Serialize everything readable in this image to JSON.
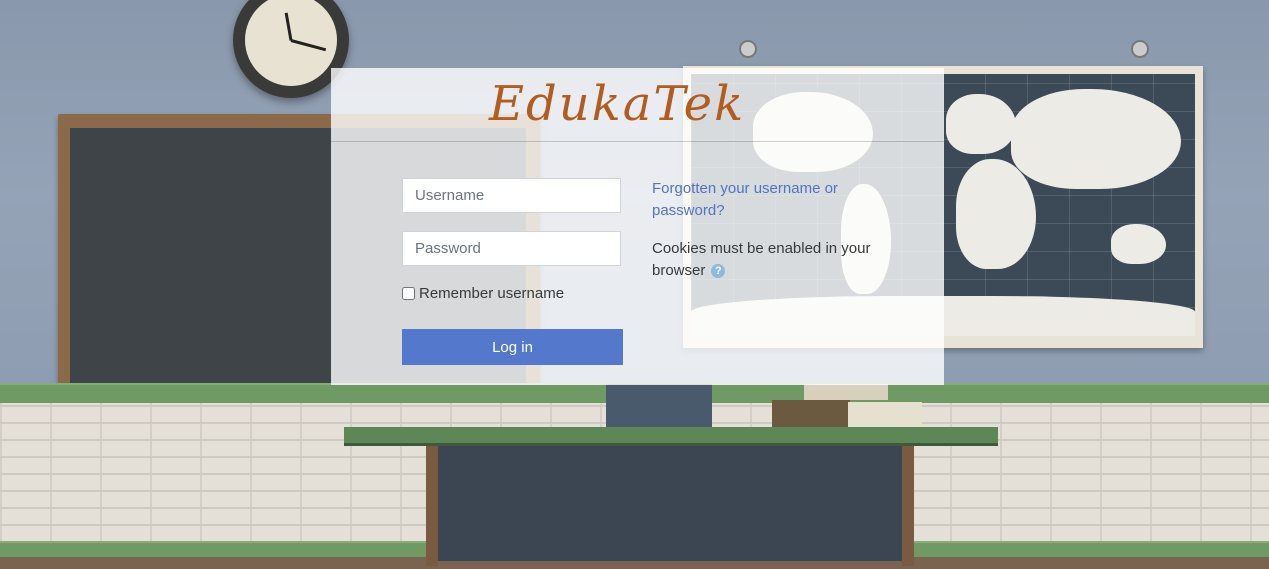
{
  "brand": {
    "logo_text": "EdukaTek",
    "logo_color": "#b25d1f"
  },
  "login_form": {
    "username_placeholder": "Username",
    "username_value": "",
    "password_placeholder": "Password",
    "password_value": "",
    "remember_label": "Remember username",
    "remember_checked": false,
    "login_button": "Log in",
    "accent_color": "#5478cb"
  },
  "help": {
    "forgot_link": "Forgotten your username or password?",
    "cookies_notice": "Cookies must be enabled in your browser",
    "help_icon": "question-circle-icon"
  }
}
